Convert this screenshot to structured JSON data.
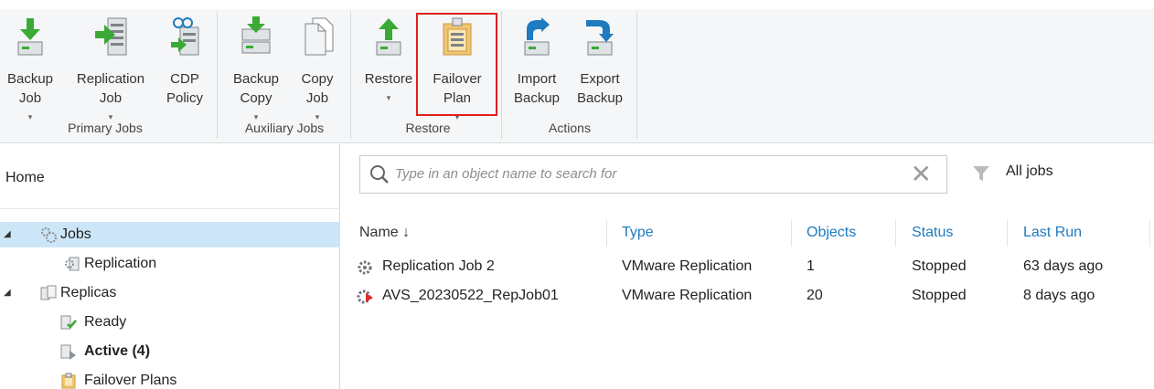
{
  "ribbon": {
    "buttons": {
      "backup_job": {
        "line1": "Backup",
        "line2": "Job"
      },
      "replication_job": {
        "line1": "Replication",
        "line2": "Job"
      },
      "cdp_policy": {
        "line1": "CDP",
        "line2": "Policy"
      },
      "backup_copy": {
        "line1": "Backup",
        "line2": "Copy"
      },
      "copy_job": {
        "line1": "Copy",
        "line2": "Job"
      },
      "restore": {
        "line1": "Restore",
        "line2": ""
      },
      "failover_plan": {
        "line1": "Failover",
        "line2": "Plan"
      },
      "import_backup": {
        "line1": "Import",
        "line2": "Backup"
      },
      "export_backup": {
        "line1": "Export",
        "line2": "Backup"
      }
    },
    "groups": {
      "primary_jobs": "Primary Jobs",
      "auxiliary_jobs": "Auxiliary Jobs",
      "restore": "Restore",
      "actions": "Actions"
    },
    "caret": "▾"
  },
  "nav": {
    "title": "Home",
    "items": {
      "jobs": "Jobs",
      "replication": "Replication",
      "replicas": "Replicas",
      "ready": "Ready",
      "active": "Active (4)",
      "failover_plans": "Failover Plans"
    },
    "bullet": "◢"
  },
  "search": {
    "placeholder": "Type in an object name to search for",
    "clear": "✕"
  },
  "filter": {
    "label": "All jobs"
  },
  "table": {
    "columns": {
      "name": "Name ↓",
      "type": "Type",
      "objects": "Objects",
      "status": "Status",
      "last_run": "Last Run"
    },
    "rows": [
      {
        "name": "Replication Job 2",
        "type": "VMware Replication",
        "objects": "1",
        "status": "Stopped",
        "last_run": "63 days ago"
      },
      {
        "name": "AVS_20230522_RepJob01",
        "type": "VMware Replication",
        "objects": "20",
        "status": "Stopped",
        "last_run": "8 days ago"
      }
    ]
  },
  "colors": {
    "accent_blue": "#1e7bbf",
    "green_arrow": "#3aaa35",
    "highlight_red": "#e02020",
    "selected_bg": "#cde6f7"
  }
}
